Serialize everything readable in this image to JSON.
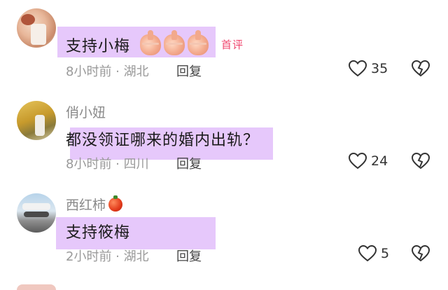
{
  "comments": [
    {
      "username": "",
      "text": "支持小梅",
      "badge": "首评",
      "time_location": "8小时前 · 湖北",
      "reply_label": "回复",
      "like_count": "35"
    },
    {
      "username": "俏小妞",
      "text": "都没领证哪来的婚内出轨？",
      "time_location": "8小时前 · 四川",
      "reply_label": "回复",
      "like_count": "24"
    },
    {
      "username": "西红柿",
      "text": "支持筱梅",
      "time_location": "2小时前 · 湖北",
      "reply_label": "回复",
      "like_count": "5"
    }
  ],
  "colors": {
    "highlight": "#e6c8fb",
    "badge": "#f0466e",
    "meta_text": "#9a9a9a"
  },
  "icons": [
    "heart-outline-icon",
    "broken-heart-icon",
    "tomato-emoji-icon",
    "thumbs-up-emoji-icon"
  ]
}
